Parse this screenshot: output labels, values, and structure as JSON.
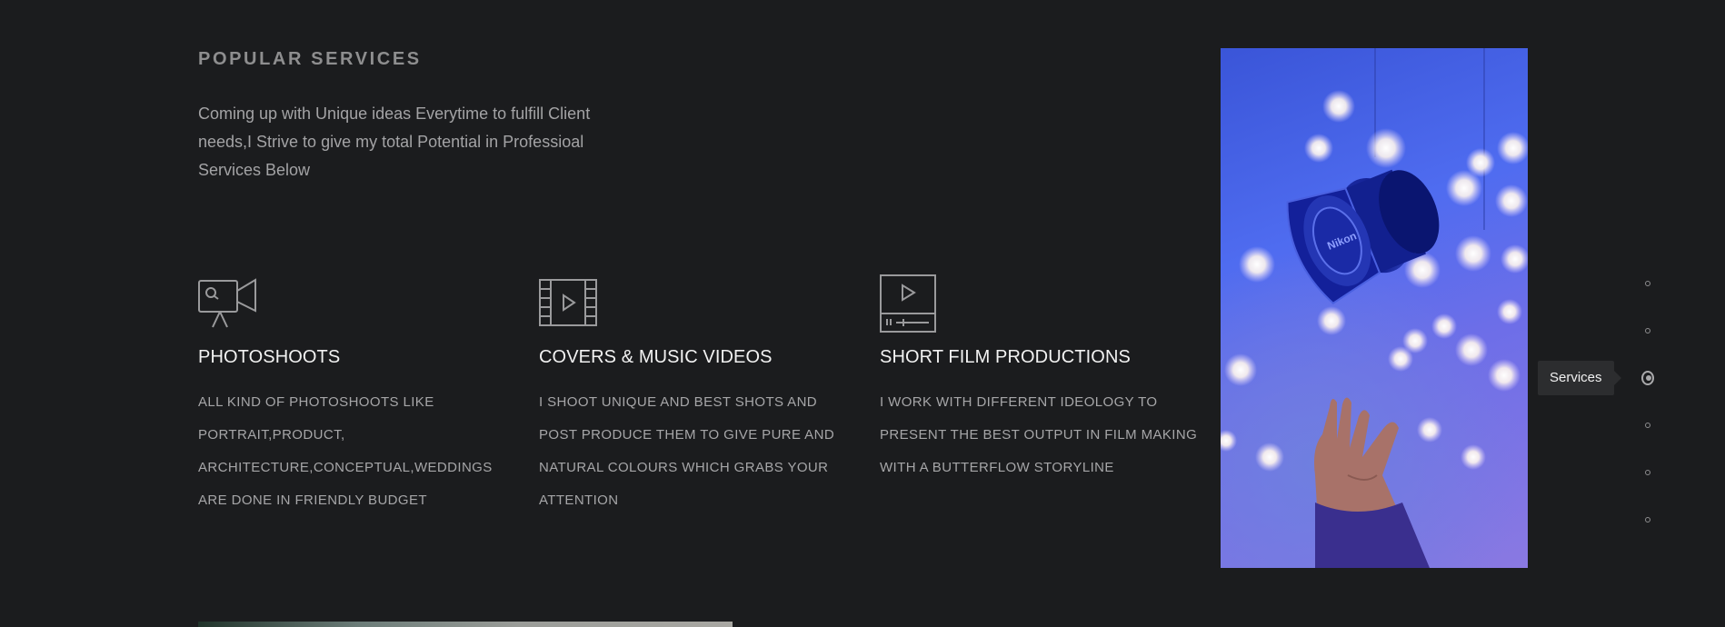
{
  "header": {
    "title": "POPULAR SERVICES",
    "intro": "Coming up with Unique ideas Everytime to fulfill Client needs,I Strive to give my total Potential in Professioal Services Below"
  },
  "services": [
    {
      "icon": "video-camera-tripod-icon",
      "title": "PHOTOSHOOTS",
      "description": "ALL KIND OF PHOTOSHOOTS LIKE PORTRAIT,PRODUCT, ARCHITECTURE,CONCEPTUAL,WEDDINGS ARE DONE IN FRIENDLY BUDGET"
    },
    {
      "icon": "film-strip-play-icon",
      "title": "COVERS & MUSIC VIDEOS",
      "description": "I SHOOT UNIQUE AND BEST SHOTS AND POST PRODUCE THEM TO GIVE PURE AND NATURAL COLOURS WHICH GRABS YOUR ATTENTION"
    },
    {
      "icon": "video-player-icon",
      "title": "SHORT FILM PRODUCTIONS",
      "description": "I WORK WITH DIFFERENT IDEOLOGY TO PRESENT THE BEST OUTPUT IN FILM MAKING WITH A BUTTERFLOW STORYLINE"
    }
  ],
  "photo": {
    "lens_text": "Nikon"
  },
  "section_nav": {
    "active_index": 2,
    "active_label": "Services",
    "count": 6
  },
  "colors": {
    "background": "#1b1c1e",
    "heading": "#8e8e8f",
    "service_title": "#f2f2f2",
    "body_text": "#a6a6a8",
    "tooltip_bg": "#2c2d2f"
  }
}
